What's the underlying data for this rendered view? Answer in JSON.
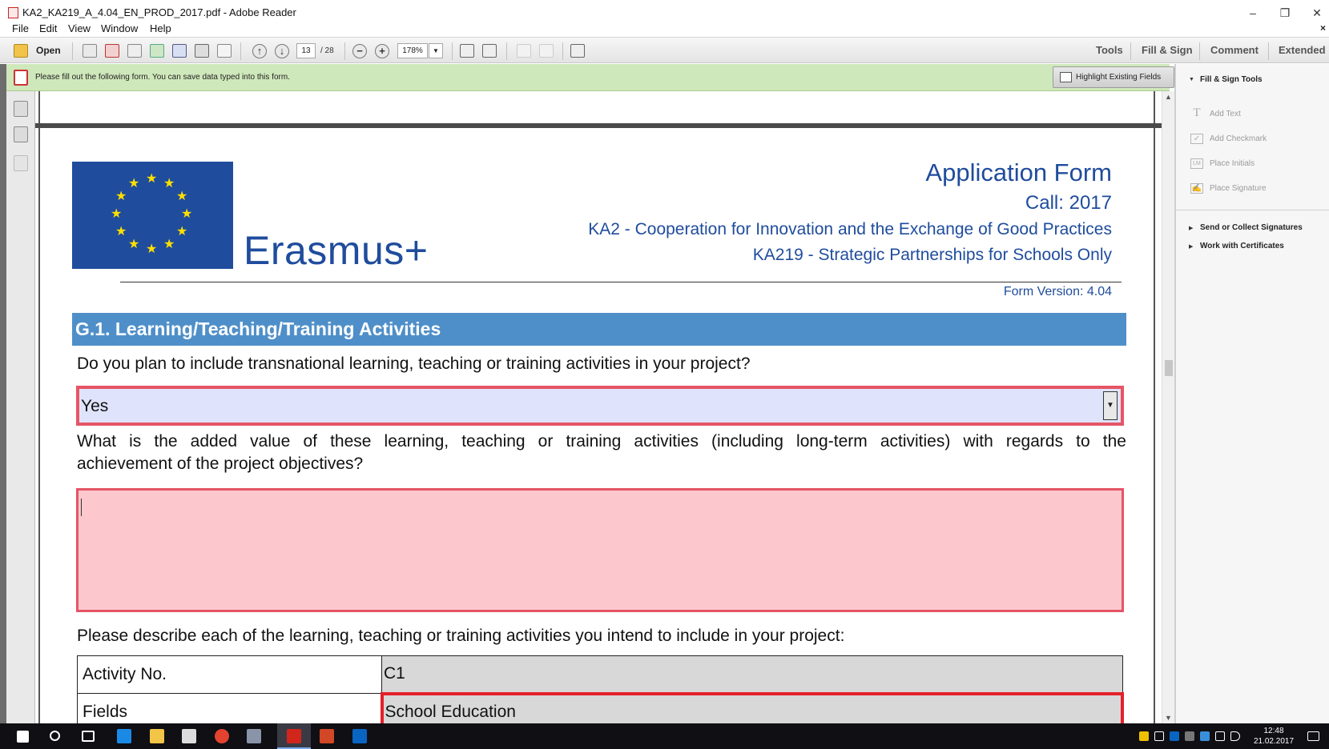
{
  "window": {
    "title": "KA2_KA219_A_4.04_EN_PROD_2017.pdf - Adobe Reader",
    "minimize": "–",
    "restore": "❐",
    "close": "✕"
  },
  "menu": {
    "items": [
      "File",
      "Edit",
      "View",
      "Window",
      "Help"
    ],
    "close_doc": "×"
  },
  "toolbar": {
    "open_label": "Open",
    "page_current": "13",
    "page_total": "/ 28",
    "zoom": "178%",
    "zoom_out": "−",
    "zoom_in": "+",
    "right_tabs": [
      "Tools",
      "Fill & Sign",
      "Comment",
      "Extended"
    ]
  },
  "notice": {
    "message": "Please fill out the following form. You can save data typed into this form.",
    "highlight_button": "Highlight Existing Fields"
  },
  "document": {
    "erasmus": "Erasmus+",
    "header_lines": [
      "Application Form",
      "Call: 2017",
      "KA2 - Cooperation for Innovation and the Exchange of Good Practices",
      "KA219 - Strategic Partnerships for Schools Only"
    ],
    "form_version": "Form Version: 4.04",
    "section_title": "G.1. Learning/Teaching/Training Activities",
    "q1": "Do you plan to include transnational learning, teaching or training activities in your project?",
    "q1_answer": "Yes",
    "q2_line1": "What is the added value of these learning, teaching or training activities (including long-term activities) with regards to the",
    "q2_line2": "achievement of the project objectives?",
    "q2_answer": "",
    "q3": "Please describe each of the learning, teaching or training activities you intend to include in your project:",
    "table": [
      {
        "label": "Activity No.",
        "value": "C1"
      },
      {
        "label": "Fields",
        "value": "School Education"
      }
    ]
  },
  "right_panel": {
    "fill_sign_tools": "Fill & Sign Tools",
    "tools": [
      "Add Text",
      "Add Checkmark",
      "Place Initials",
      "Place Signature"
    ],
    "sections": [
      "Send or Collect Signatures",
      "Work with Certificates"
    ]
  },
  "taskbar": {
    "time": "12:48",
    "date": "21.02.2017"
  },
  "colors": {
    "brand_blue": "#1f4c9d",
    "section_blue": "#4f8fc9",
    "required_red": "#e55565",
    "notice_green": "#cfe8bb"
  }
}
